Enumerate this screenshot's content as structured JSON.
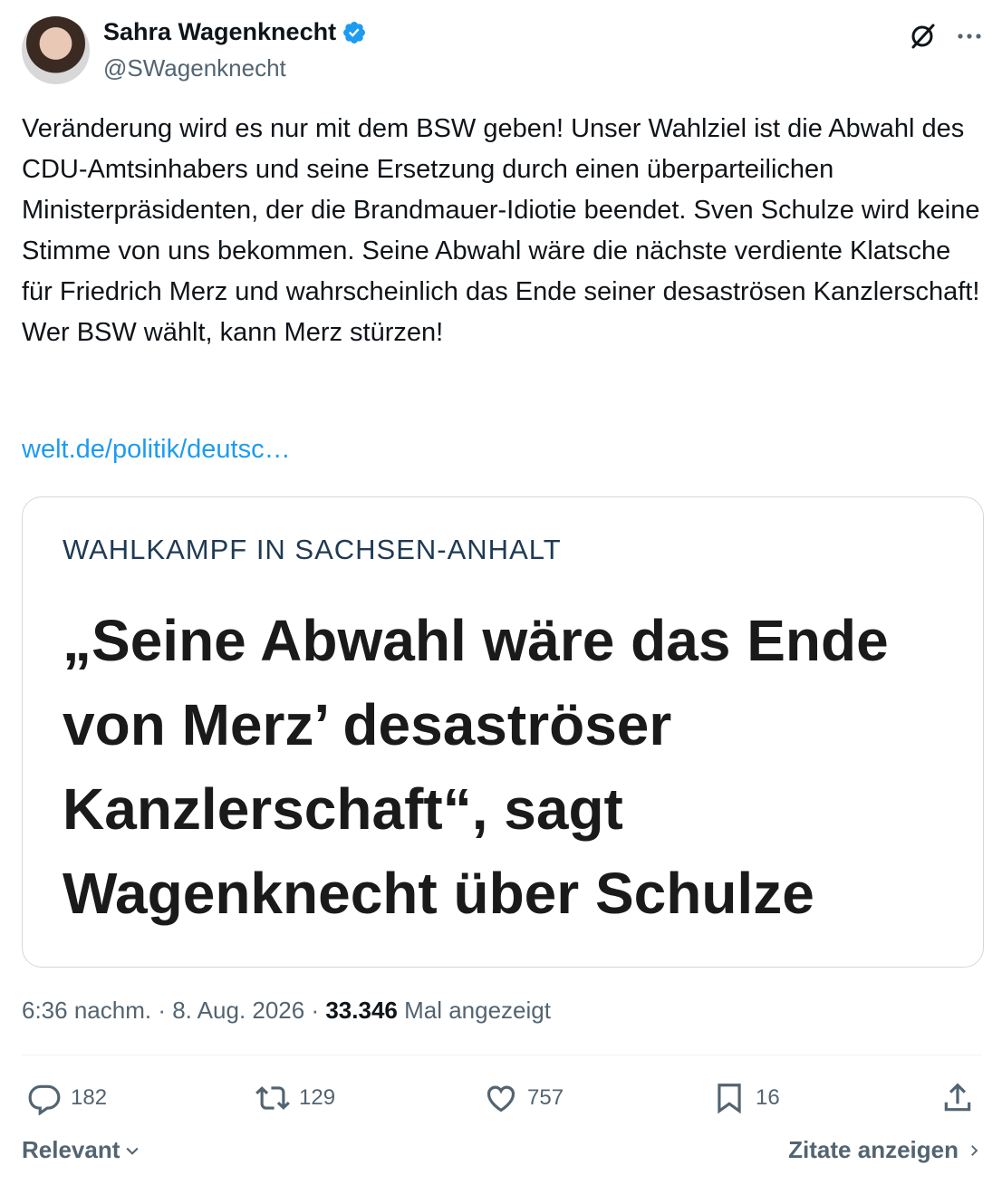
{
  "author": {
    "name": "Sahra Wagenknecht",
    "handle": "@SWagenknecht"
  },
  "tweet": {
    "text": "Veränderung wird es nur mit dem BSW geben! Unser Wahlziel ist die Abwahl des CDU-Amtsinhabers und seine Ersetzung durch einen überparteilichen Ministerpräsidenten, der die Brandmauer-Idiotie beendet. Sven Schulze wird keine Stimme von uns bekommen. Seine Abwahl wäre die nächste verdiente Klatsche für Friedrich Merz und wahrscheinlich das Ende seiner desaströsen Kanzlerschaft! Wer BSW wählt, kann Merz stürzen!",
    "link": "welt.de/politik/deutsc…"
  },
  "card": {
    "kicker": "WAHLKAMPF IN SACHSEN-ANHALT",
    "headline": "„Seine Abwahl wäre das Ende von Merz’ desaströser Kanzlerschaft“, sagt Wagenknecht über Schulze"
  },
  "meta": {
    "time": "6:36 nachm.",
    "sep1": " · ",
    "date": "8. Aug. 2026",
    "sep2": " · ",
    "views": "33.346",
    "views_label": " Mal angezeigt"
  },
  "actions": {
    "replies": "182",
    "reposts": "129",
    "likes": "757",
    "bookmarks": "16"
  },
  "footer": {
    "sort_label": "Relevant",
    "quotes_label": "Zitate anzeigen"
  },
  "colors": {
    "link": "#1d9bf0",
    "muted": "#536471",
    "text": "#0f1419",
    "verified": "#1d9bf0"
  }
}
